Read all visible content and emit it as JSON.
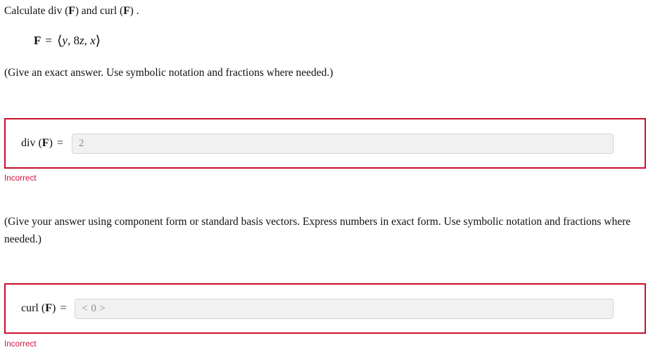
{
  "question": {
    "prompt_prefix": "Calculate ",
    "prompt_div": "div",
    "prompt_paren_open": " (",
    "vector_symbol": "F",
    "prompt_paren_close": ")",
    "prompt_and": " and ",
    "prompt_curl": "curl",
    "prompt_period": " ."
  },
  "formula": {
    "lhs": "F",
    "equals": "=",
    "bracket_open": "⟨",
    "component_1": "y",
    "comma_1": ", ",
    "component_2_coef": "8",
    "component_2_var": "z",
    "comma_2": ", ",
    "component_3": "x",
    "bracket_close": "⟩",
    "full_text": "F = ⟨y, 8z, x⟩"
  },
  "instructions": {
    "first": "(Give an exact answer. Use symbolic notation and fractions where needed.)",
    "second": "(Give your answer using component form or standard basis vectors. Express numbers in exact form. Use symbolic notation and fractions where needed.)"
  },
  "answers": [
    {
      "operator": "div",
      "paren_open": " (",
      "vector": "F",
      "paren_close": ")",
      "equals": "=",
      "input_value": "2",
      "input_placeholder": "",
      "status": "Incorrect"
    },
    {
      "operator": "curl",
      "paren_open": " (",
      "vector": "F",
      "paren_close": ")",
      "equals": "=",
      "input_value": "< 0 >",
      "input_placeholder": "",
      "status": "Incorrect"
    }
  ],
  "colors": {
    "error_border": "#c8102e",
    "error_text": "#d0103a",
    "input_background": "#f1f1f1",
    "input_border": "#d6d6d6",
    "input_text": "#8b8b8b",
    "body_text": "#111111"
  }
}
